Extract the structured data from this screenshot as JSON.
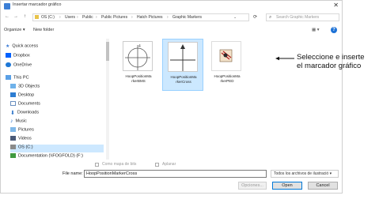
{
  "window": {
    "title": "Insertar marcador gráfico",
    "close_symbol": "✕"
  },
  "nav": {
    "back": "←",
    "forward": "→",
    "up": "↑",
    "breadcrumb": [
      "OS (C:)",
      "Users",
      "Public",
      "Public Pictures",
      "Hatch Pictures",
      "Graphic Markers"
    ],
    "refresh": "⟳",
    "search_placeholder": "Search Graphic Markers"
  },
  "toolbar": {
    "organize": "Organize ▾",
    "new_folder": "New folder",
    "view": "▦ ▾",
    "help": "?"
  },
  "sidebar": {
    "items": [
      {
        "label": "Quick access",
        "icon": "star-icon"
      },
      {
        "label": "Dropbox",
        "icon": "dropbox-icon"
      },
      {
        "label": "OneDrive",
        "icon": "cloud-icon"
      },
      {
        "label": "This PC",
        "icon": "computer-icon"
      },
      {
        "label": "3D Objects",
        "icon": "cube-icon"
      },
      {
        "label": "Desktop",
        "icon": "desktop-icon"
      },
      {
        "label": "Documents",
        "icon": "document-icon"
      },
      {
        "label": "Downloads",
        "icon": "download-icon"
      },
      {
        "label": "Music",
        "icon": "music-icon"
      },
      {
        "label": "Pictures",
        "icon": "pictures-icon"
      },
      {
        "label": "Videos",
        "icon": "video-icon"
      },
      {
        "label": "OS (C:)",
        "icon": "drive-icon"
      },
      {
        "label": "Documentation (\\\\FOGFOLD) (F:)",
        "icon": "network-drive-icon"
      }
    ]
  },
  "files": [
    {
      "name_line1": "HoopPositionMa",
      "name_line2": "rkerBMS"
    },
    {
      "name_line1": "HoopPositionMa",
      "name_line2": "rkerCross"
    },
    {
      "name_line1": "HoopPositionMa",
      "name_line2": "rkerPED"
    }
  ],
  "options": {
    "stitch_maps": "Como mapa de bits",
    "flatten": "Aplanar"
  },
  "footer": {
    "file_name_label": "File name:",
    "file_name_value": "HoopPositionMarkerCross",
    "file_type": "Todos los archivos de ilustració ▾",
    "options_button": "Opciones...",
    "open_button": "Open",
    "cancel_button": "Cancel"
  },
  "callout": {
    "line1": "Seleccione e inserte",
    "line2": "el marcador gráfico"
  },
  "colors": {
    "accent": "#0078d7",
    "selection": "#cce8ff"
  }
}
